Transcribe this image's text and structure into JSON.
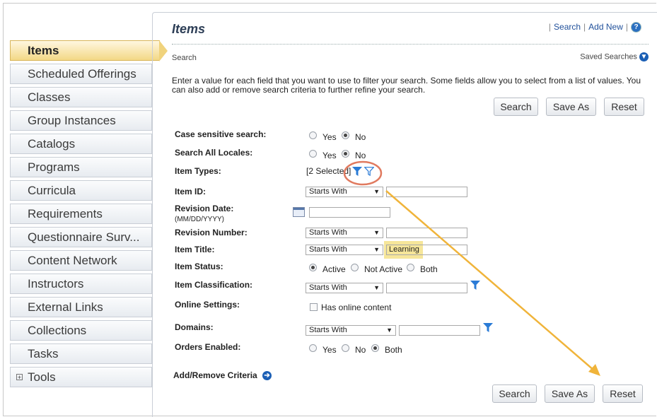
{
  "sidebar": {
    "items": [
      {
        "label": "Items",
        "active": true
      },
      {
        "label": "Scheduled Offerings"
      },
      {
        "label": "Classes"
      },
      {
        "label": "Group Instances"
      },
      {
        "label": "Catalogs"
      },
      {
        "label": "Programs"
      },
      {
        "label": "Curricula"
      },
      {
        "label": "Requirements"
      },
      {
        "label": "Questionnaire Surv..."
      },
      {
        "label": "Content Network"
      },
      {
        "label": "Instructors"
      },
      {
        "label": "External Links"
      },
      {
        "label": "Collections"
      },
      {
        "label": "Tasks"
      },
      {
        "label": "Tools",
        "expandable": true
      }
    ]
  },
  "header": {
    "title": "Items",
    "links": {
      "search": "Search",
      "add_new": "Add New",
      "help": "?"
    }
  },
  "section": {
    "title": "Search",
    "saved_searches": "Saved Searches"
  },
  "intro": "Enter a value for each field that you want to use to filter your search. Some fields allow you to select from a list of values. You can also add or remove search criteria to further refine your search.",
  "buttons": {
    "search": "Search",
    "save_as": "Save As",
    "reset": "Reset"
  },
  "form": {
    "case_sensitive": {
      "label": "Case sensitive search:",
      "yes": "Yes",
      "no": "No",
      "selected": "No"
    },
    "all_locales": {
      "label": "Search All Locales:",
      "yes": "Yes",
      "no": "No",
      "selected": "No"
    },
    "item_types": {
      "label": "Item Types:",
      "value": "[2 Selected]"
    },
    "item_id": {
      "label": "Item ID:",
      "operator": "Starts With",
      "value": ""
    },
    "revision_date": {
      "label": "Revision Date:",
      "hint": "(MM/DD/YYYY)",
      "value": ""
    },
    "revision_number": {
      "label": "Revision Number:",
      "operator": "Starts With",
      "value": ""
    },
    "item_title": {
      "label": "Item Title:",
      "operator": "Starts With",
      "value": "Learning"
    },
    "item_status": {
      "label": "Item Status:",
      "active": "Active",
      "not_active": "Not Active",
      "both": "Both",
      "selected": "Active"
    },
    "item_classification": {
      "label": "Item Classification:",
      "operator": "Starts With",
      "value": ""
    },
    "online_settings": {
      "label": "Online Settings:",
      "checkbox": "Has online content",
      "checked": false
    },
    "domains": {
      "label": "Domains:",
      "operator": "Starts With",
      "value": ""
    },
    "orders_enabled": {
      "label": "Orders Enabled:",
      "yes": "Yes",
      "no": "No",
      "both": "Both",
      "selected": "Both"
    }
  },
  "add_remove": "Add/Remove Criteria",
  "colors": {
    "accent": "#1f4f9a",
    "active_tab": "#f3d886",
    "annotation": "#f0b43a",
    "circle": "#e07a5f",
    "filter": "#2a7bd6"
  }
}
